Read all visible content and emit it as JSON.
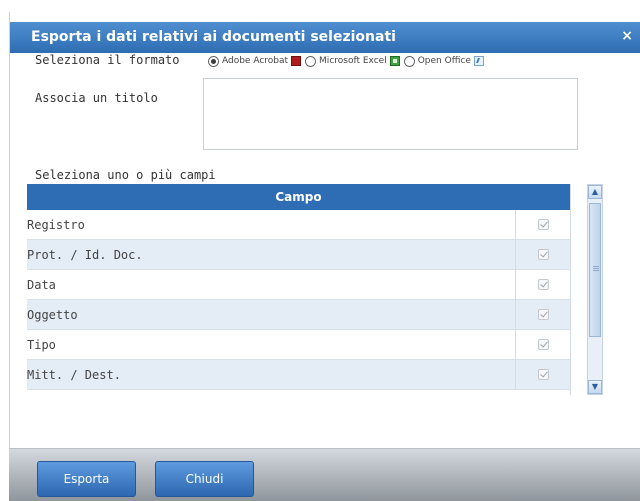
{
  "dialog": {
    "title": "Esporta i dati relativi ai documenti selezionati",
    "close_icon": "×"
  },
  "format": {
    "label": "Seleziona il formato",
    "options": [
      {
        "label": "Adobe Acrobat",
        "icon": "pdf-icon",
        "selected": true
      },
      {
        "label": "Microsoft Excel",
        "icon": "excel-icon",
        "selected": false
      },
      {
        "label": "Open Office",
        "icon": "openoffice-icon",
        "selected": false
      }
    ]
  },
  "title_field": {
    "label": "Associa un titolo",
    "value": ""
  },
  "fields": {
    "label": "Seleziona uno o più campi",
    "column_header": "Campo",
    "rows": [
      {
        "name": "Registro",
        "checked": true
      },
      {
        "name": "Prot. / Id. Doc.",
        "checked": true
      },
      {
        "name": "Data",
        "checked": true
      },
      {
        "name": "Oggetto",
        "checked": true
      },
      {
        "name": "Tipo",
        "checked": true
      },
      {
        "name": "Mitt. / Dest.",
        "checked": true
      }
    ]
  },
  "buttons": {
    "export": "Esporta",
    "close": "Chiudi"
  },
  "colors": {
    "header_blue": "#2e6db3",
    "row_alt": "#e4ecf5"
  }
}
